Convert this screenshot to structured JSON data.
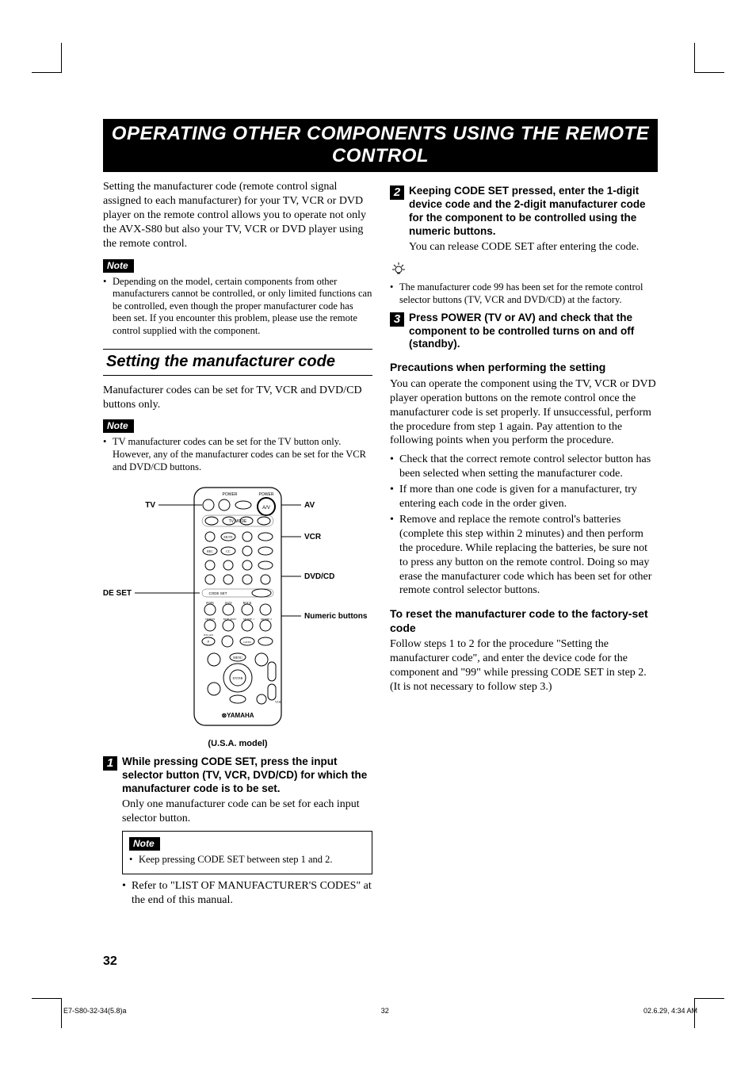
{
  "banner": "OPERATING OTHER COMPONENTS USING THE REMOTE CONTROL",
  "left": {
    "intro": "Setting the manufacturer code (remote control signal assigned to each manufacturer) for your TV, VCR or DVD player on the remote control allows you to operate not only the AVX-S80 but also your TV, VCR or DVD player using the remote control.",
    "note_label": "Note",
    "note1": "Depending on the model, certain components from other manufacturers cannot be controlled, or only limited functions can be controlled, even though the proper manufacturer code has been set. If you encounter this problem, please use the remote control supplied with the component.",
    "section_title": "Setting the manufacturer code",
    "section_body": "Manufacturer codes can be set for TV, VCR and DVD/CD buttons only.",
    "note2": "TV manufacturer codes can be set for the TV button only. However, any of the manufacturer codes can be set for the VCR and DVD/CD buttons.",
    "remote": {
      "tv": "TV",
      "av": "AV",
      "vcr": "VCR",
      "dvdcd": "DVD/CD",
      "codeset": "CODE SET",
      "numeric": "Numeric buttons",
      "caption": "(U.S.A. model)"
    },
    "step1_head": "While pressing CODE SET, press the input selector button (TV, VCR, DVD/CD) for which the manufacturer code is to be set.",
    "step1_body": "Only one manufacturer code can be set for each input selector button.",
    "step1_note": "Keep pressing CODE SET between step 1 and 2.",
    "step1_ref": "Refer to \"LIST OF MANUFACTURER'S CODES\" at the end of this manual."
  },
  "right": {
    "step2_head": "Keeping CODE SET pressed, enter the 1-digit device code and the 2-digit manufacturer code for the component to be controlled using the numeric buttons.",
    "step2_body": "You can release CODE SET after entering the code.",
    "hint": "The manufacturer code 99 has been set for the remote control selector buttons (TV, VCR and DVD/CD) at the factory.",
    "step3_head": "Press POWER (TV or AV) and check that the component to be controlled turns on and off (standby).",
    "precautions_title": "Precautions when performing the setting",
    "precautions_intro": "You can operate the component using the TV, VCR or DVD player operation buttons on the remote control once the manufacturer code is set properly. If unsuccessful, perform the procedure from step 1 again. Pay attention to the following points when you perform the procedure.",
    "pc1": "Check that the correct remote control selector button has been selected when setting the manufacturer code.",
    "pc2": "If more than one code is given for a manufacturer, try entering each code in the order given.",
    "pc3": "Remove and replace the remote control's batteries (complete this step within 2 minutes) and then perform the procedure. While replacing the batteries, be sure not to press any button on the remote control. Doing so may erase the manufacturer code which has been set for other remote control selector buttons.",
    "reset_title": "To reset the manufacturer code to the factory-set code",
    "reset_body": "Follow steps 1 to 2 for the procedure \"Setting the manufacturer code\", and enter the device code for the component and \"99\" while pressing CODE SET in step 2. (It is not necessary to follow step 3.)"
  },
  "page_number": "32",
  "footer": {
    "left": "E7-S80-32-34(5.8)a",
    "center": "32",
    "right": "02.6.29, 4:34 AM"
  }
}
